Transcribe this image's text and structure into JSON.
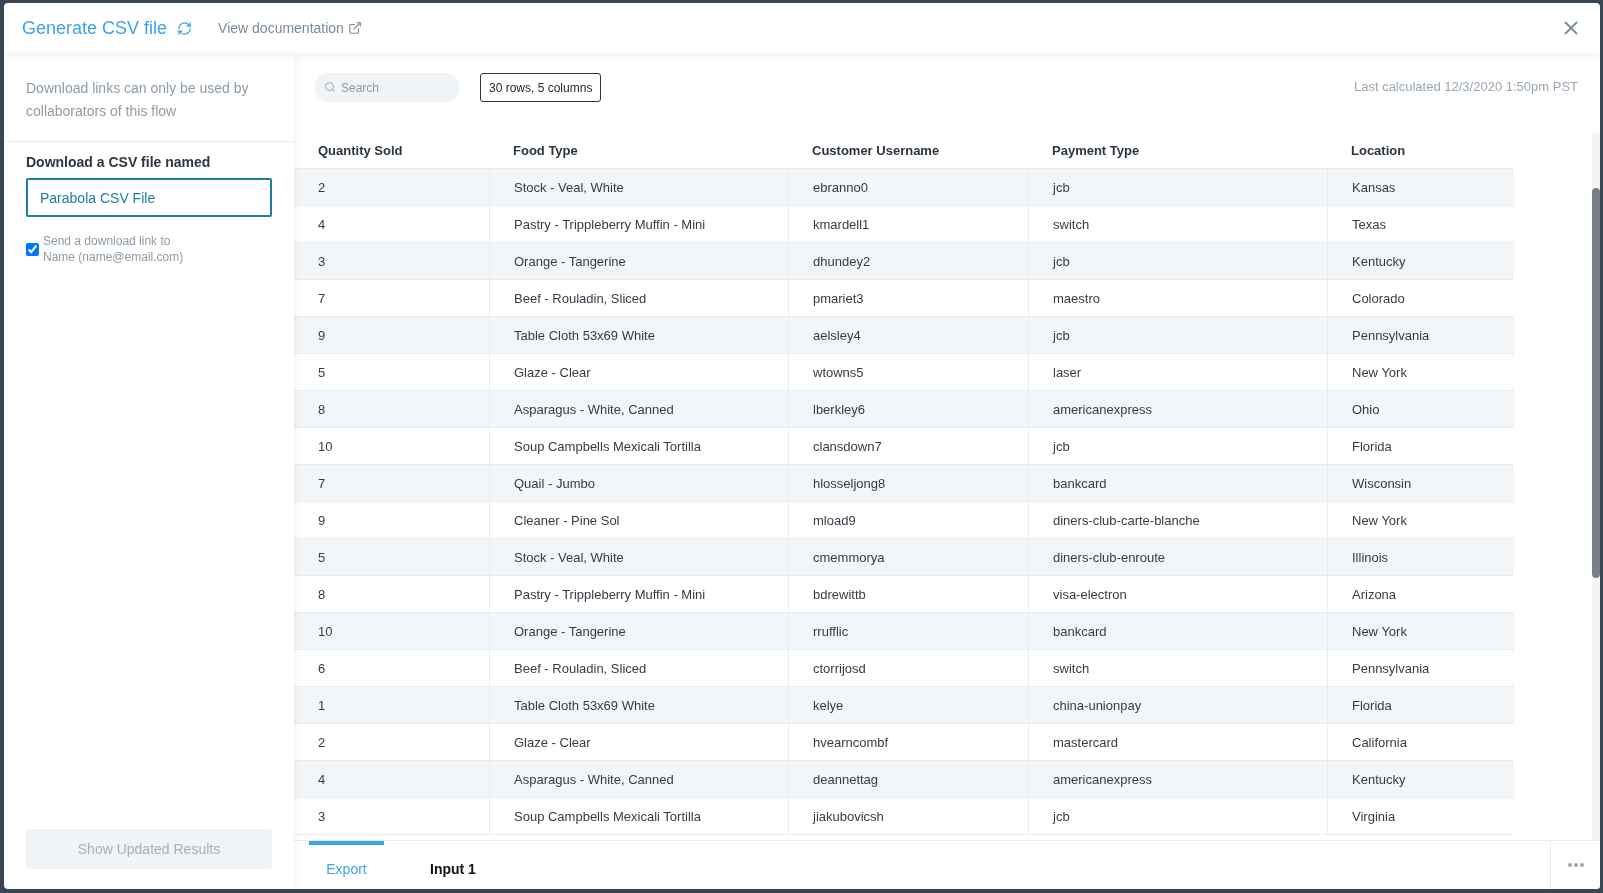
{
  "header": {
    "title": "Generate CSV file",
    "doc_link": "View documentation"
  },
  "sidebar": {
    "notice": "Download links can only be used by collaborators of this flow",
    "file_label": "Download a CSV file named",
    "file_name": "Parabola CSV File",
    "send_link": {
      "checked": true,
      "line1": "Send a download link to",
      "line2": "Name (name@email.com)"
    },
    "button": {
      "label": "Show Updated Results",
      "disabled": true
    }
  },
  "toolbar": {
    "search_placeholder": "Search",
    "summary": "30 rows, 5 columns",
    "last_calculated": "Last calculated 12/3/2020 1:50pm PST"
  },
  "table": {
    "columns": [
      "Quantity Sold",
      "Food Type",
      "Customer Username",
      "Payment Type",
      "Location"
    ],
    "rows": [
      [
        "2",
        "Stock - Veal, White",
        "ebranno0",
        "jcb",
        "Kansas"
      ],
      [
        "4",
        "Pastry - Trippleberry Muffin - Mini",
        "kmardell1",
        "switch",
        "Texas"
      ],
      [
        "3",
        "Orange - Tangerine",
        "dhundey2",
        "jcb",
        "Kentucky"
      ],
      [
        "7",
        "Beef - Rouladin, Sliced",
        "pmariet3",
        "maestro",
        "Colorado"
      ],
      [
        "9",
        "Table Cloth 53x69 White",
        "aelsley4",
        "jcb",
        "Pennsylvania"
      ],
      [
        "5",
        "Glaze - Clear",
        "wtowns5",
        "laser",
        "New York"
      ],
      [
        "8",
        "Asparagus - White, Canned",
        "lberkley6",
        "americanexpress",
        "Ohio"
      ],
      [
        "10",
        "Soup Campbells Mexicali Tortilla",
        "clansdown7",
        "jcb",
        "Florida"
      ],
      [
        "7",
        "Quail - Jumbo",
        "hlosseljong8",
        "bankcard",
        "Wisconsin"
      ],
      [
        "9",
        "Cleaner - Pine Sol",
        "mload9",
        "diners-club-carte-blanche",
        "New York"
      ],
      [
        "5",
        "Stock - Veal, White",
        "cmemmorya",
        "diners-club-enroute",
        "Illinois"
      ],
      [
        "8",
        "Pastry - Trippleberry Muffin - Mini",
        "bdrewittb",
        "visa-electron",
        "Arizona"
      ],
      [
        "10",
        "Orange - Tangerine",
        "rrufflic",
        "bankcard",
        "New York"
      ],
      [
        "6",
        "Beef - Rouladin, Sliced",
        "ctorrijosd",
        "switch",
        "Pennsylvania"
      ],
      [
        "1",
        "Table Cloth 53x69 White",
        "kelye",
        "china-unionpay",
        "Florida"
      ],
      [
        "2",
        "Glaze - Clear",
        "hvearncombf",
        "mastercard",
        "California"
      ],
      [
        "4",
        "Asparagus - White, Canned",
        "deannettag",
        "americanexpress",
        "Kentucky"
      ],
      [
        "3",
        "Soup Campbells Mexicali Tortilla",
        "jiakubovicsh",
        "jcb",
        "Virginia"
      ]
    ]
  },
  "bottom_tabs": [
    {
      "label": "Export",
      "selected": true
    },
    {
      "label": "Input 1",
      "selected": false
    }
  ]
}
